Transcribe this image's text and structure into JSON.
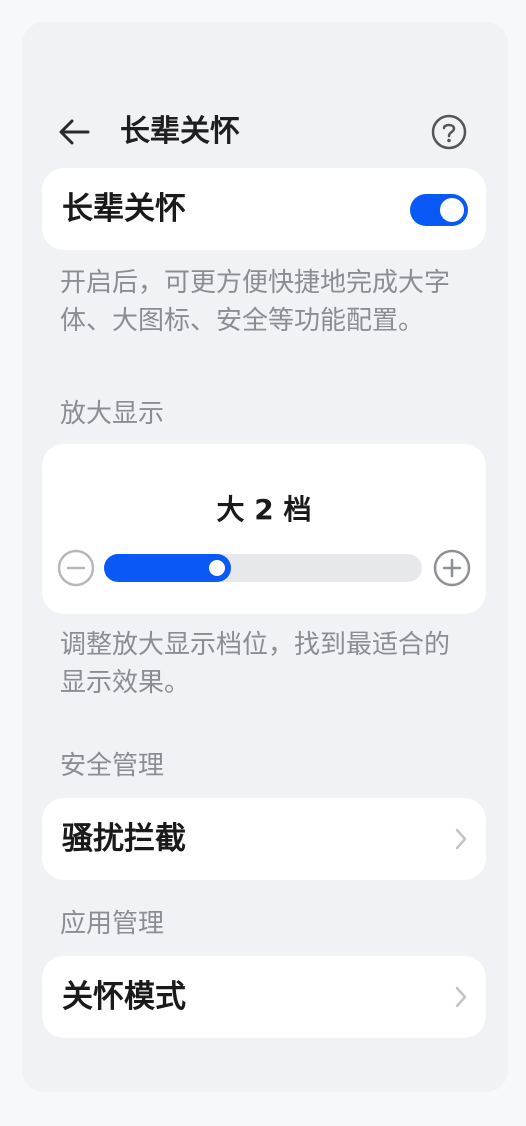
{
  "header": {
    "title": "长辈关怀"
  },
  "elder_care": {
    "label": "长辈关怀",
    "toggle_on": true,
    "description": "开启后，可更方便快捷地完成大字体、大图标、安全等功能配置。"
  },
  "zoom": {
    "section_title": "放大显示",
    "value_label": "大 2 档",
    "level_fraction": 0.4,
    "description": "调整放大显示档位，找到最适合的显示效果。"
  },
  "security": {
    "section_title": "安全管理",
    "item_label": "骚扰拦截"
  },
  "app_management": {
    "section_title": "应用管理",
    "item_label": "关怀模式"
  },
  "colors": {
    "accent": "#0a59f7",
    "background": "#f0f2f5",
    "card": "#ffffff",
    "secondary_text": "#8a8d93"
  },
  "icons": {
    "back": "back-arrow-icon",
    "help": "help-icon",
    "minus": "zoom-out-icon",
    "plus": "zoom-in-icon",
    "chevron": "chevron-right-icon"
  }
}
